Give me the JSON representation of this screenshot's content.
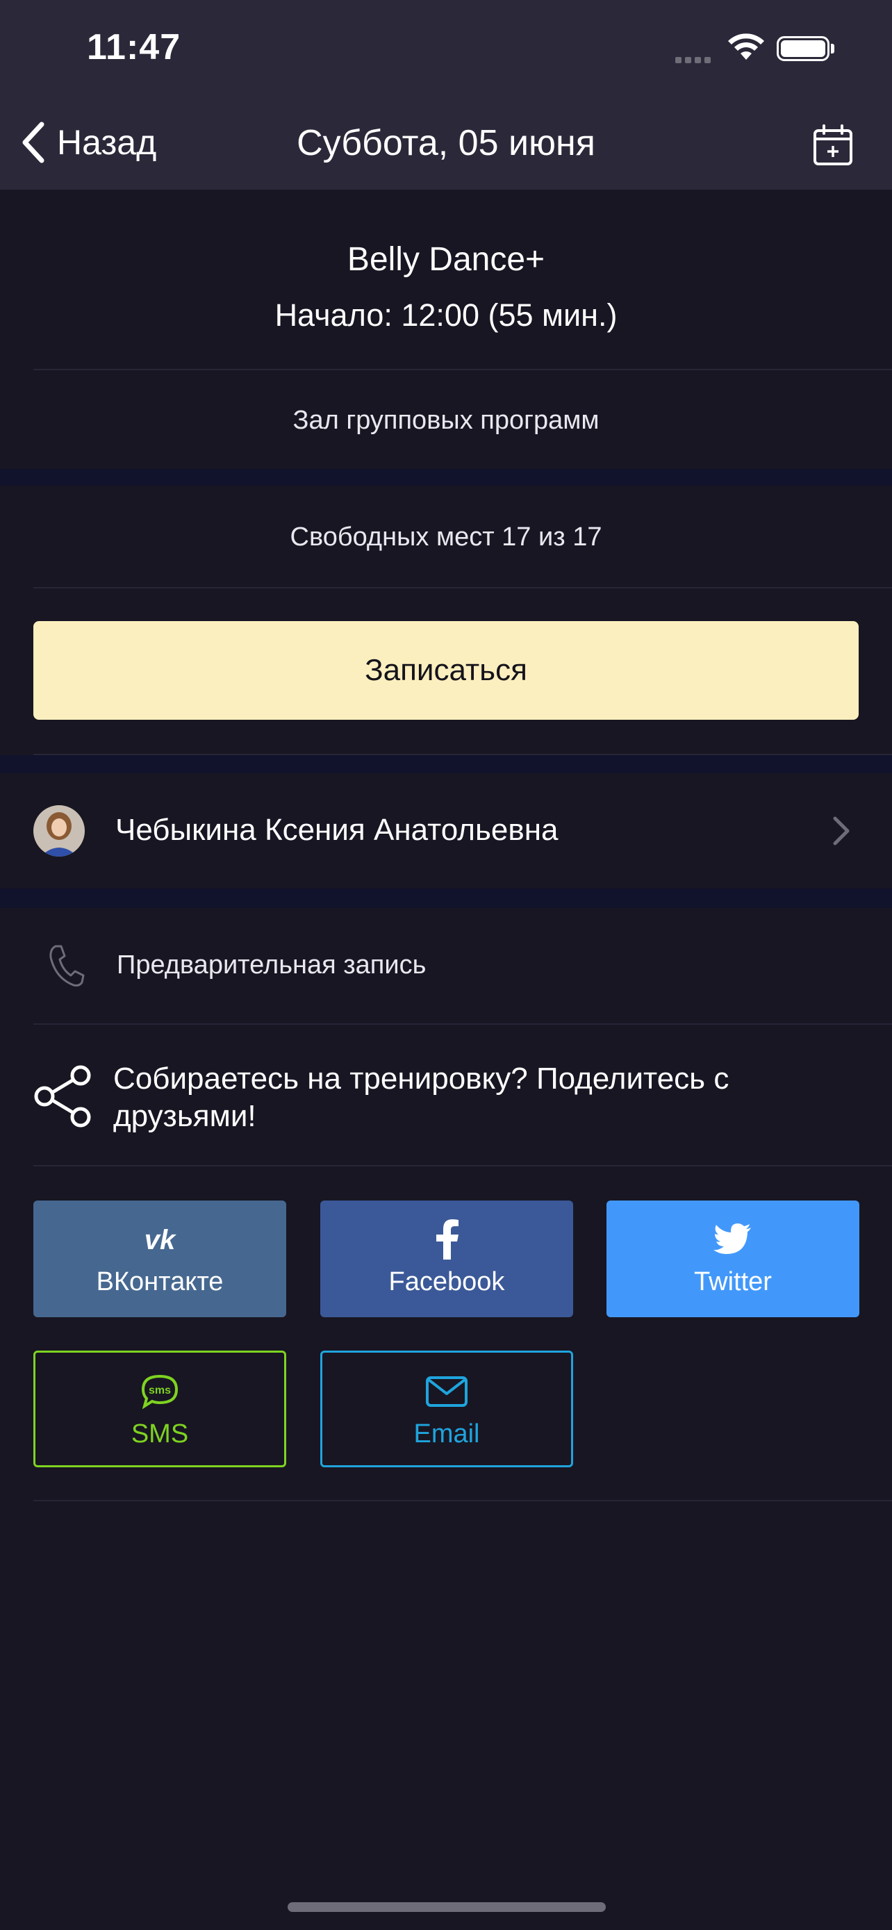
{
  "status_bar": {
    "time": "11:47"
  },
  "nav": {
    "back_label": "Назад",
    "title": "Суббота, 05 июня"
  },
  "class_info": {
    "name": "Belly Dance+",
    "start": "Начало: 12:00 (55 мин.)",
    "room": "Зал групповых программ",
    "free_spots": "Свободных мест 17 из 17"
  },
  "signup_label": "Записаться",
  "trainer": {
    "name": "Чебыкина Ксения Анатольевна"
  },
  "pre_booking": "Предварительная запись",
  "share": {
    "prompt": "Собираетесь на тренировку? Поделитесь с друзьями!",
    "buttons": {
      "vk": "ВКонтакте",
      "facebook": "Facebook",
      "twitter": "Twitter",
      "sms": "SMS",
      "email": "Email"
    }
  },
  "colors": {
    "header_bg": "#2b2939",
    "page_bg": "#181622",
    "section_band": "#11122c",
    "signup_button": "#fcefbf",
    "vk": "#466890",
    "facebook": "#3b5998",
    "twitter": "#4298fa",
    "sms": "#7ed321",
    "email": "#1fa4dd"
  },
  "icons": [
    "chevron-left-icon",
    "calendar-plus-icon",
    "chevron-right-icon",
    "phone-icon",
    "share-icon",
    "vk-icon",
    "facebook-icon",
    "twitter-icon",
    "sms-icon",
    "email-icon",
    "wifi-icon",
    "battery-icon",
    "signal-icon"
  ]
}
